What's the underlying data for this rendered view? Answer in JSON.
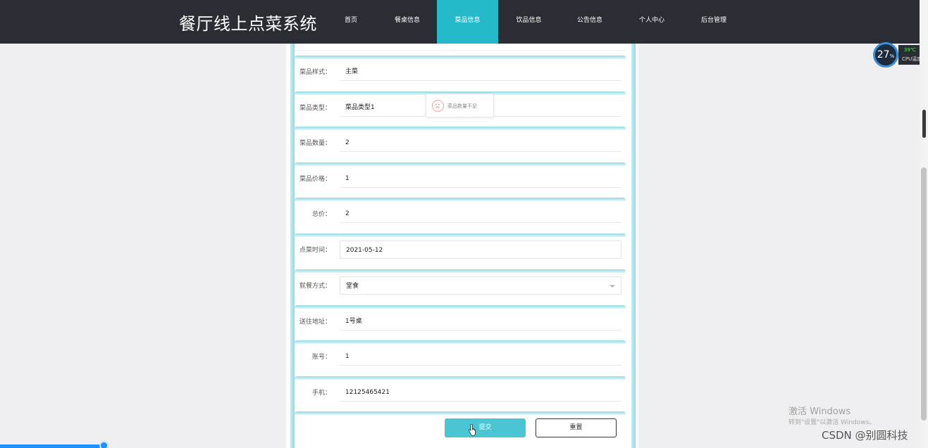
{
  "header": {
    "brand": "餐厅线上点菜系统",
    "nav": [
      {
        "label": "首页",
        "active": false
      },
      {
        "label": "餐桌信息",
        "active": false
      },
      {
        "label": "菜品信息",
        "active": true
      },
      {
        "label": "饮品信息",
        "active": false
      },
      {
        "label": "公告信息",
        "active": false
      },
      {
        "label": "个人中心",
        "active": false
      },
      {
        "label": "后台管理",
        "active": false
      }
    ]
  },
  "form": {
    "fields": [
      {
        "label": "菜品样式：",
        "value": "主菜"
      },
      {
        "label": "菜品类型：",
        "value": "菜品类型1"
      },
      {
        "label": "菜品数量：",
        "value": "2"
      },
      {
        "label": "菜品价格：",
        "value": "1"
      },
      {
        "label": "总价：",
        "value": "2"
      },
      {
        "label": "点菜时间：",
        "value": "2021-05-12"
      },
      {
        "label": "就餐方式：",
        "value": "堂食"
      },
      {
        "label": "送往地址：",
        "value": "1号桌"
      },
      {
        "label": "账号：",
        "value": "1"
      },
      {
        "label": "手机：",
        "value": "12125465421"
      }
    ],
    "submit_label": "提交",
    "reset_label": "重置"
  },
  "toast": {
    "message": "菜品数量不足"
  },
  "widget": {
    "cpu_percent": "27",
    "percent_sign": "%",
    "temp": "39℃",
    "label": "CPU温度"
  },
  "watermark": {
    "line1": "激活 Windows",
    "line2": "转到\"设置\"以激活 Windows。",
    "csdn": "CSDN @别圆科技"
  },
  "colors": {
    "accent": "#25b9c9",
    "header_bg": "#2a2d34",
    "submit_bg": "#4ac5d4"
  }
}
